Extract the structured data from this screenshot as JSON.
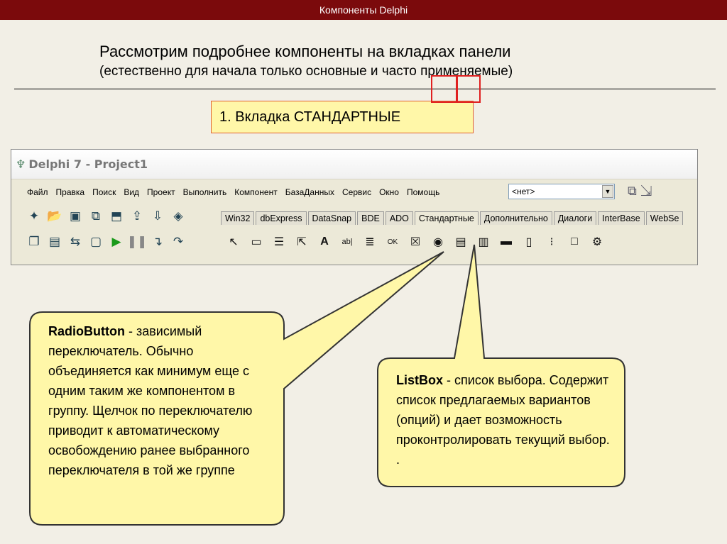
{
  "header": {
    "title": "Компоненты Delphi"
  },
  "intro": {
    "line1": "Рассмотрим подробнее компоненты на вкладках панели",
    "line2": "(естественно для начала только основные и часто применяемые)"
  },
  "tab_label": "1. Вкладка СТАНДАРТНЫЕ",
  "ide": {
    "title": "Delphi 7 - Project1",
    "menu": [
      "Файл",
      "Правка",
      "Поиск",
      "Вид",
      "Проект",
      "Выполнить",
      "Компонент",
      "БазаДанных",
      "Сервис",
      "Окно",
      "Помощь"
    ],
    "combo_value": "<нет>",
    "palette_tabs": [
      "Win32",
      "dbExpress",
      "DataSnap",
      "BDE",
      "ADO",
      "Стандартные",
      "Дополнительно",
      "Диалоги",
      "InterBase",
      "WebSe"
    ],
    "active_tab": "Стандартные"
  },
  "callout_radio": {
    "term": "RadioButton",
    "text": " - зависимый переключатель. Обычно объединяется как минимум еще с одним таким же компонентом в группу. Щелчок по переключателю приводит к автоматическому освобождению ранее выбранного переключателя в той же группе"
  },
  "callout_list": {
    "term": "ListBox",
    "text": " - список выбора. Содержит список предлагаемых вариантов (опций) и дает возможность проконтролировать текущий выбор. ."
  },
  "colors": {
    "topbar": "#7b0a0c",
    "callout_fill": "#fff7a8",
    "highlight": "#e02020"
  }
}
